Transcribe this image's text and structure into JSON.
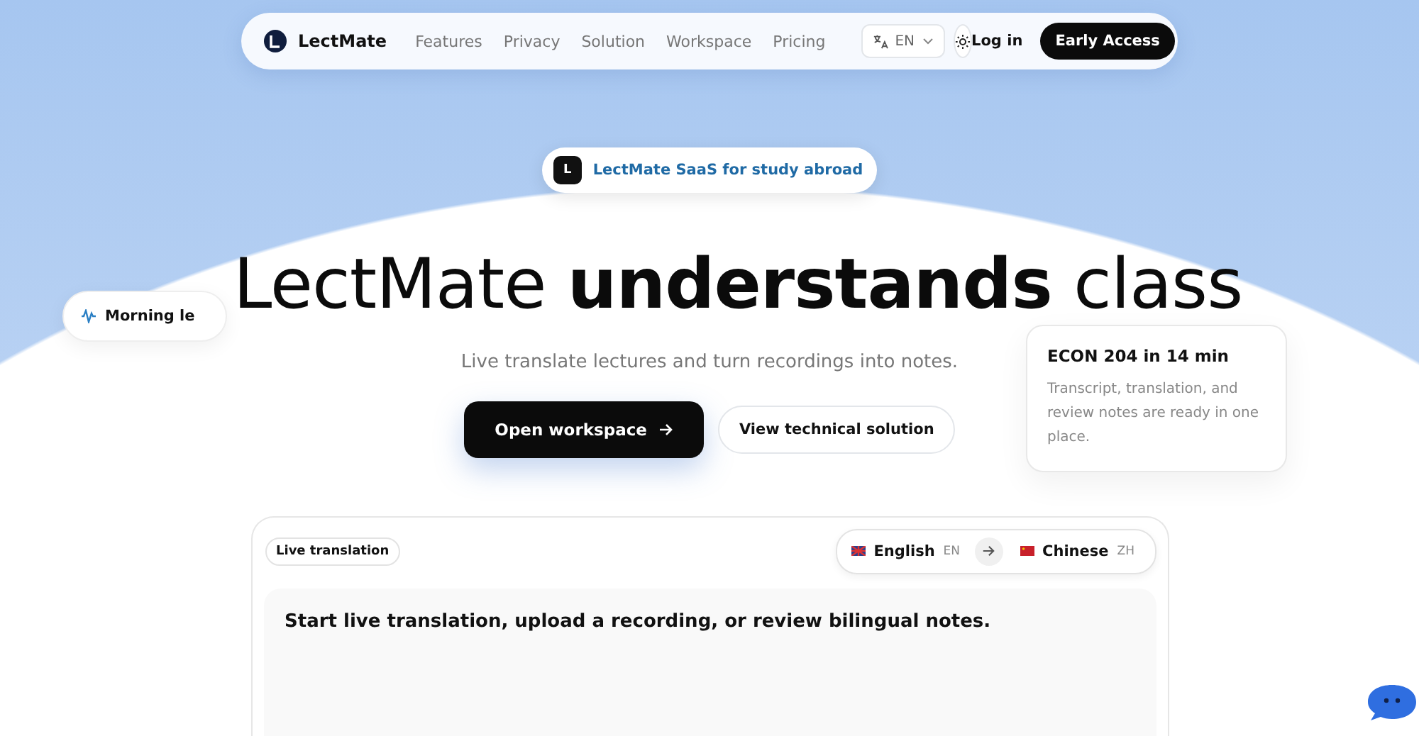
{
  "nav": {
    "brand": "LectMate",
    "links": [
      {
        "label": "Features"
      },
      {
        "label": "Privacy"
      },
      {
        "label": "Solution"
      },
      {
        "label": "Workspace"
      },
      {
        "label": "Pricing"
      }
    ],
    "language": "EN",
    "login": "Log in",
    "cta": "Early Access"
  },
  "hero": {
    "badge_mark": "L",
    "badge": "LectMate SaaS for study abroad",
    "chip": "Morning le",
    "title": "LectMate **understands** class",
    "subtitle": "Live translate lectures and turn recordings into notes.",
    "primary": "Open workspace",
    "secondary": "View technical solution"
  },
  "side_card": {
    "title": "ECON 204 in 14 min",
    "body": "Transcript, translation, and review notes are ready in one place."
  },
  "panel": {
    "tag": "Live translation",
    "source": {
      "name": "English",
      "code": "EN"
    },
    "target": {
      "name": "Chinese",
      "code": "ZH"
    },
    "prompt": "Start live translation, upload a recording, or review bilingual notes."
  }
}
